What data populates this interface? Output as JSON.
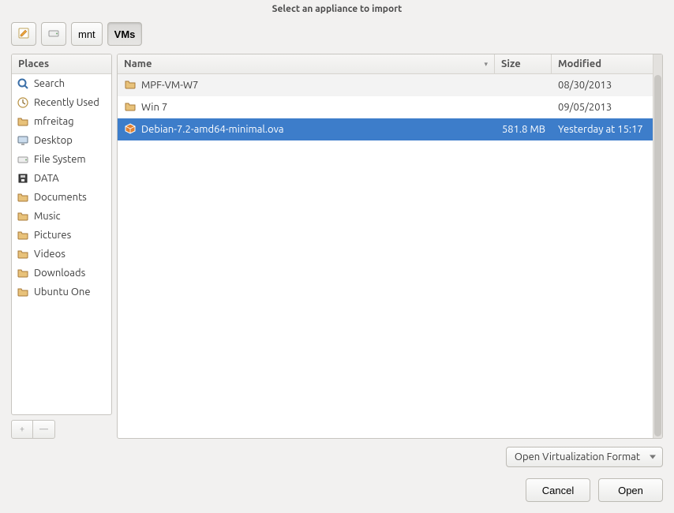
{
  "title": "Select an appliance to import",
  "path": {
    "drive_icon": "drive-icon",
    "mnt": "mnt",
    "VMs": "VMs"
  },
  "sidebar": {
    "header": "Places",
    "items": [
      {
        "icon": "search-icon",
        "label": "Search"
      },
      {
        "icon": "clock-icon",
        "label": "Recently Used"
      },
      {
        "icon": "folder-home-icon",
        "label": "mfreitag"
      },
      {
        "icon": "desktop-icon",
        "label": "Desktop"
      },
      {
        "icon": "drive-icon",
        "label": "File System"
      },
      {
        "icon": "disk-icon",
        "label": "DATA"
      },
      {
        "icon": "folder-icon",
        "label": "Documents"
      },
      {
        "icon": "folder-icon",
        "label": "Music"
      },
      {
        "icon": "folder-icon",
        "label": "Pictures"
      },
      {
        "icon": "folder-icon",
        "label": "Videos"
      },
      {
        "icon": "folder-icon",
        "label": "Downloads"
      },
      {
        "icon": "folder-icon",
        "label": "Ubuntu One"
      }
    ]
  },
  "columns": {
    "name": "Name",
    "size": "Size",
    "modified": "Modified"
  },
  "files": [
    {
      "icon": "folder-icon",
      "name": "MPF-VM-W7",
      "size": "",
      "modified": "08/30/2013",
      "selected": false
    },
    {
      "icon": "folder-icon",
      "name": "Win 7",
      "size": "",
      "modified": "09/05/2013",
      "selected": false
    },
    {
      "icon": "package-icon",
      "name": "Debian-7.2-amd64-minimal.ova",
      "size": "581.8 MB",
      "modified": "Yesterday at 15:17",
      "selected": true
    }
  ],
  "filter": "Open Virtualization Format",
  "buttons": {
    "cancel": "Cancel",
    "open": "Open"
  },
  "add": "+",
  "remove": "—"
}
